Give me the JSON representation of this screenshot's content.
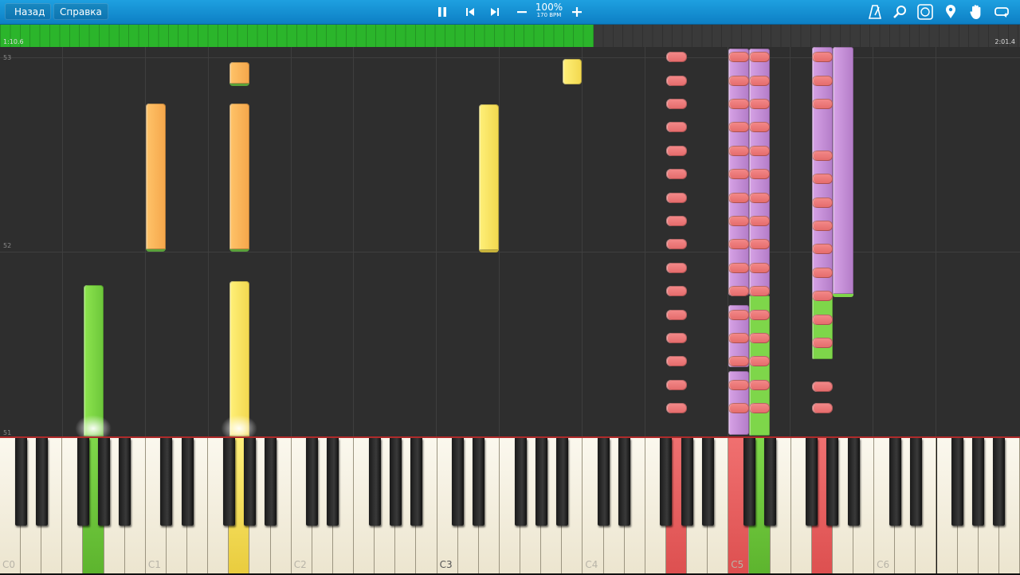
{
  "topbar": {
    "back_label": "Назад",
    "help_label": "Справка",
    "tempo_percent": "100%",
    "tempo_bpm": "170 BPM",
    "icons": [
      "metronome-icon",
      "magnifier-icon",
      "key-label-icon",
      "location-pin-icon",
      "hand-icon",
      "loop-icon"
    ]
  },
  "progress": {
    "elapsed": "1:10.6",
    "total": "2:01.4",
    "fraction": 0.582
  },
  "roll": {
    "measures": [
      "53",
      "52",
      "51"
    ]
  },
  "keyboard": {
    "octave_labels": [
      "C0",
      "C1",
      "C2",
      "C3",
      "C4",
      "C5",
      "C6"
    ]
  },
  "colors": {
    "accent": "#1ea0e0",
    "progress": "#2bb52b",
    "note_green": "#7ed64a",
    "note_orange": "#f5a64a",
    "note_yellow": "#f2d84e",
    "note_pink": "#e46a6a",
    "note_purple": "#b37cc8"
  }
}
